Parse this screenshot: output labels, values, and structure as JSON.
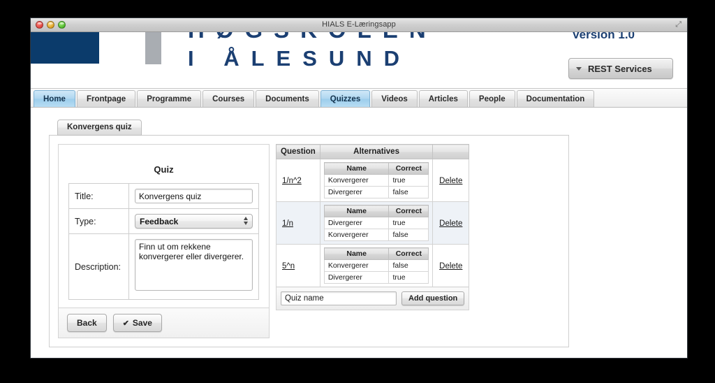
{
  "window": {
    "title": "HIALS E-Læringsapp",
    "traffic_lights": [
      "close-button",
      "minimize-button",
      "zoom-button"
    ],
    "resize_glyph": "⤢"
  },
  "header": {
    "wordmark_top": "HØGSKOLEN",
    "wordmark": "I ÅLESUND",
    "version": "Version 1.0",
    "rest_button": "REST Services",
    "brand_blue": "#0b3b6b",
    "gray_bar": "#a9adb2"
  },
  "nav": {
    "tabs": [
      {
        "label": "Home",
        "active": true
      },
      {
        "label": "Frontpage",
        "active": false
      },
      {
        "label": "Programme",
        "active": false
      },
      {
        "label": "Courses",
        "active": false
      },
      {
        "label": "Documents",
        "active": false
      },
      {
        "label": "Quizzes",
        "active": true
      },
      {
        "label": "Videos",
        "active": false
      },
      {
        "label": "Articles",
        "active": false
      },
      {
        "label": "People",
        "active": false
      },
      {
        "label": "Documentation",
        "active": false
      }
    ],
    "active_color": "#aed6f0"
  },
  "panel": {
    "tab_label": "Konvergens quiz"
  },
  "quiz_form": {
    "heading": "Quiz",
    "title_label": "Title:",
    "title_value": "Konvergens quiz",
    "type_label": "Type:",
    "type_value": "Feedback",
    "description_label": "Description:",
    "description_value": "Finn ut om rekkene konvergerer eller divergerer.",
    "back_button": "Back",
    "save_button": "Save",
    "save_check": "✔"
  },
  "questions_table": {
    "headers": {
      "question": "Question",
      "alternatives": "Alternatives",
      "action": ""
    },
    "alt_headers": {
      "name": "Name",
      "correct": "Correct"
    },
    "delete_label": "Delete",
    "rows": [
      {
        "question": "1/n^2",
        "alternatives": [
          {
            "name": "Konvergerer",
            "correct": "true"
          },
          {
            "name": "Divergerer",
            "correct": "false"
          }
        ]
      },
      {
        "question": "1/n",
        "alternatives": [
          {
            "name": "Divergerer",
            "correct": "true"
          },
          {
            "name": "Konvergerer",
            "correct": "false"
          }
        ]
      },
      {
        "question": "5^n",
        "alternatives": [
          {
            "name": "Konvergerer",
            "correct": "false"
          },
          {
            "name": "Divergerer",
            "correct": "true"
          }
        ]
      }
    ],
    "add_row": {
      "input_placeholder": "Quiz name",
      "input_value": "",
      "button_label": "Add question"
    }
  }
}
